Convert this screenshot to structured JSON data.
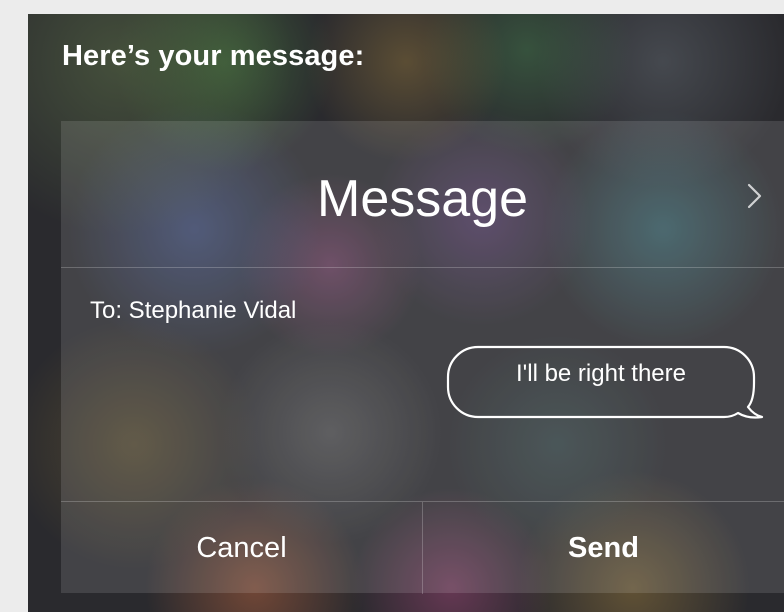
{
  "siri": {
    "prompt": "Here’s your message:"
  },
  "message_card": {
    "app_title": "Message",
    "open_icon": "chevron-right-icon",
    "recipient": "To: Stephanie Vidal",
    "body": "I'll be right there"
  },
  "actions": {
    "cancel_label": "Cancel",
    "send_label": "Send"
  },
  "colors": {
    "text": "#ffffff",
    "card_overlay": "rgba(255,255,255,0.12)",
    "divider": "rgba(255,255,255,0.22)",
    "page_background": "#ececec"
  }
}
